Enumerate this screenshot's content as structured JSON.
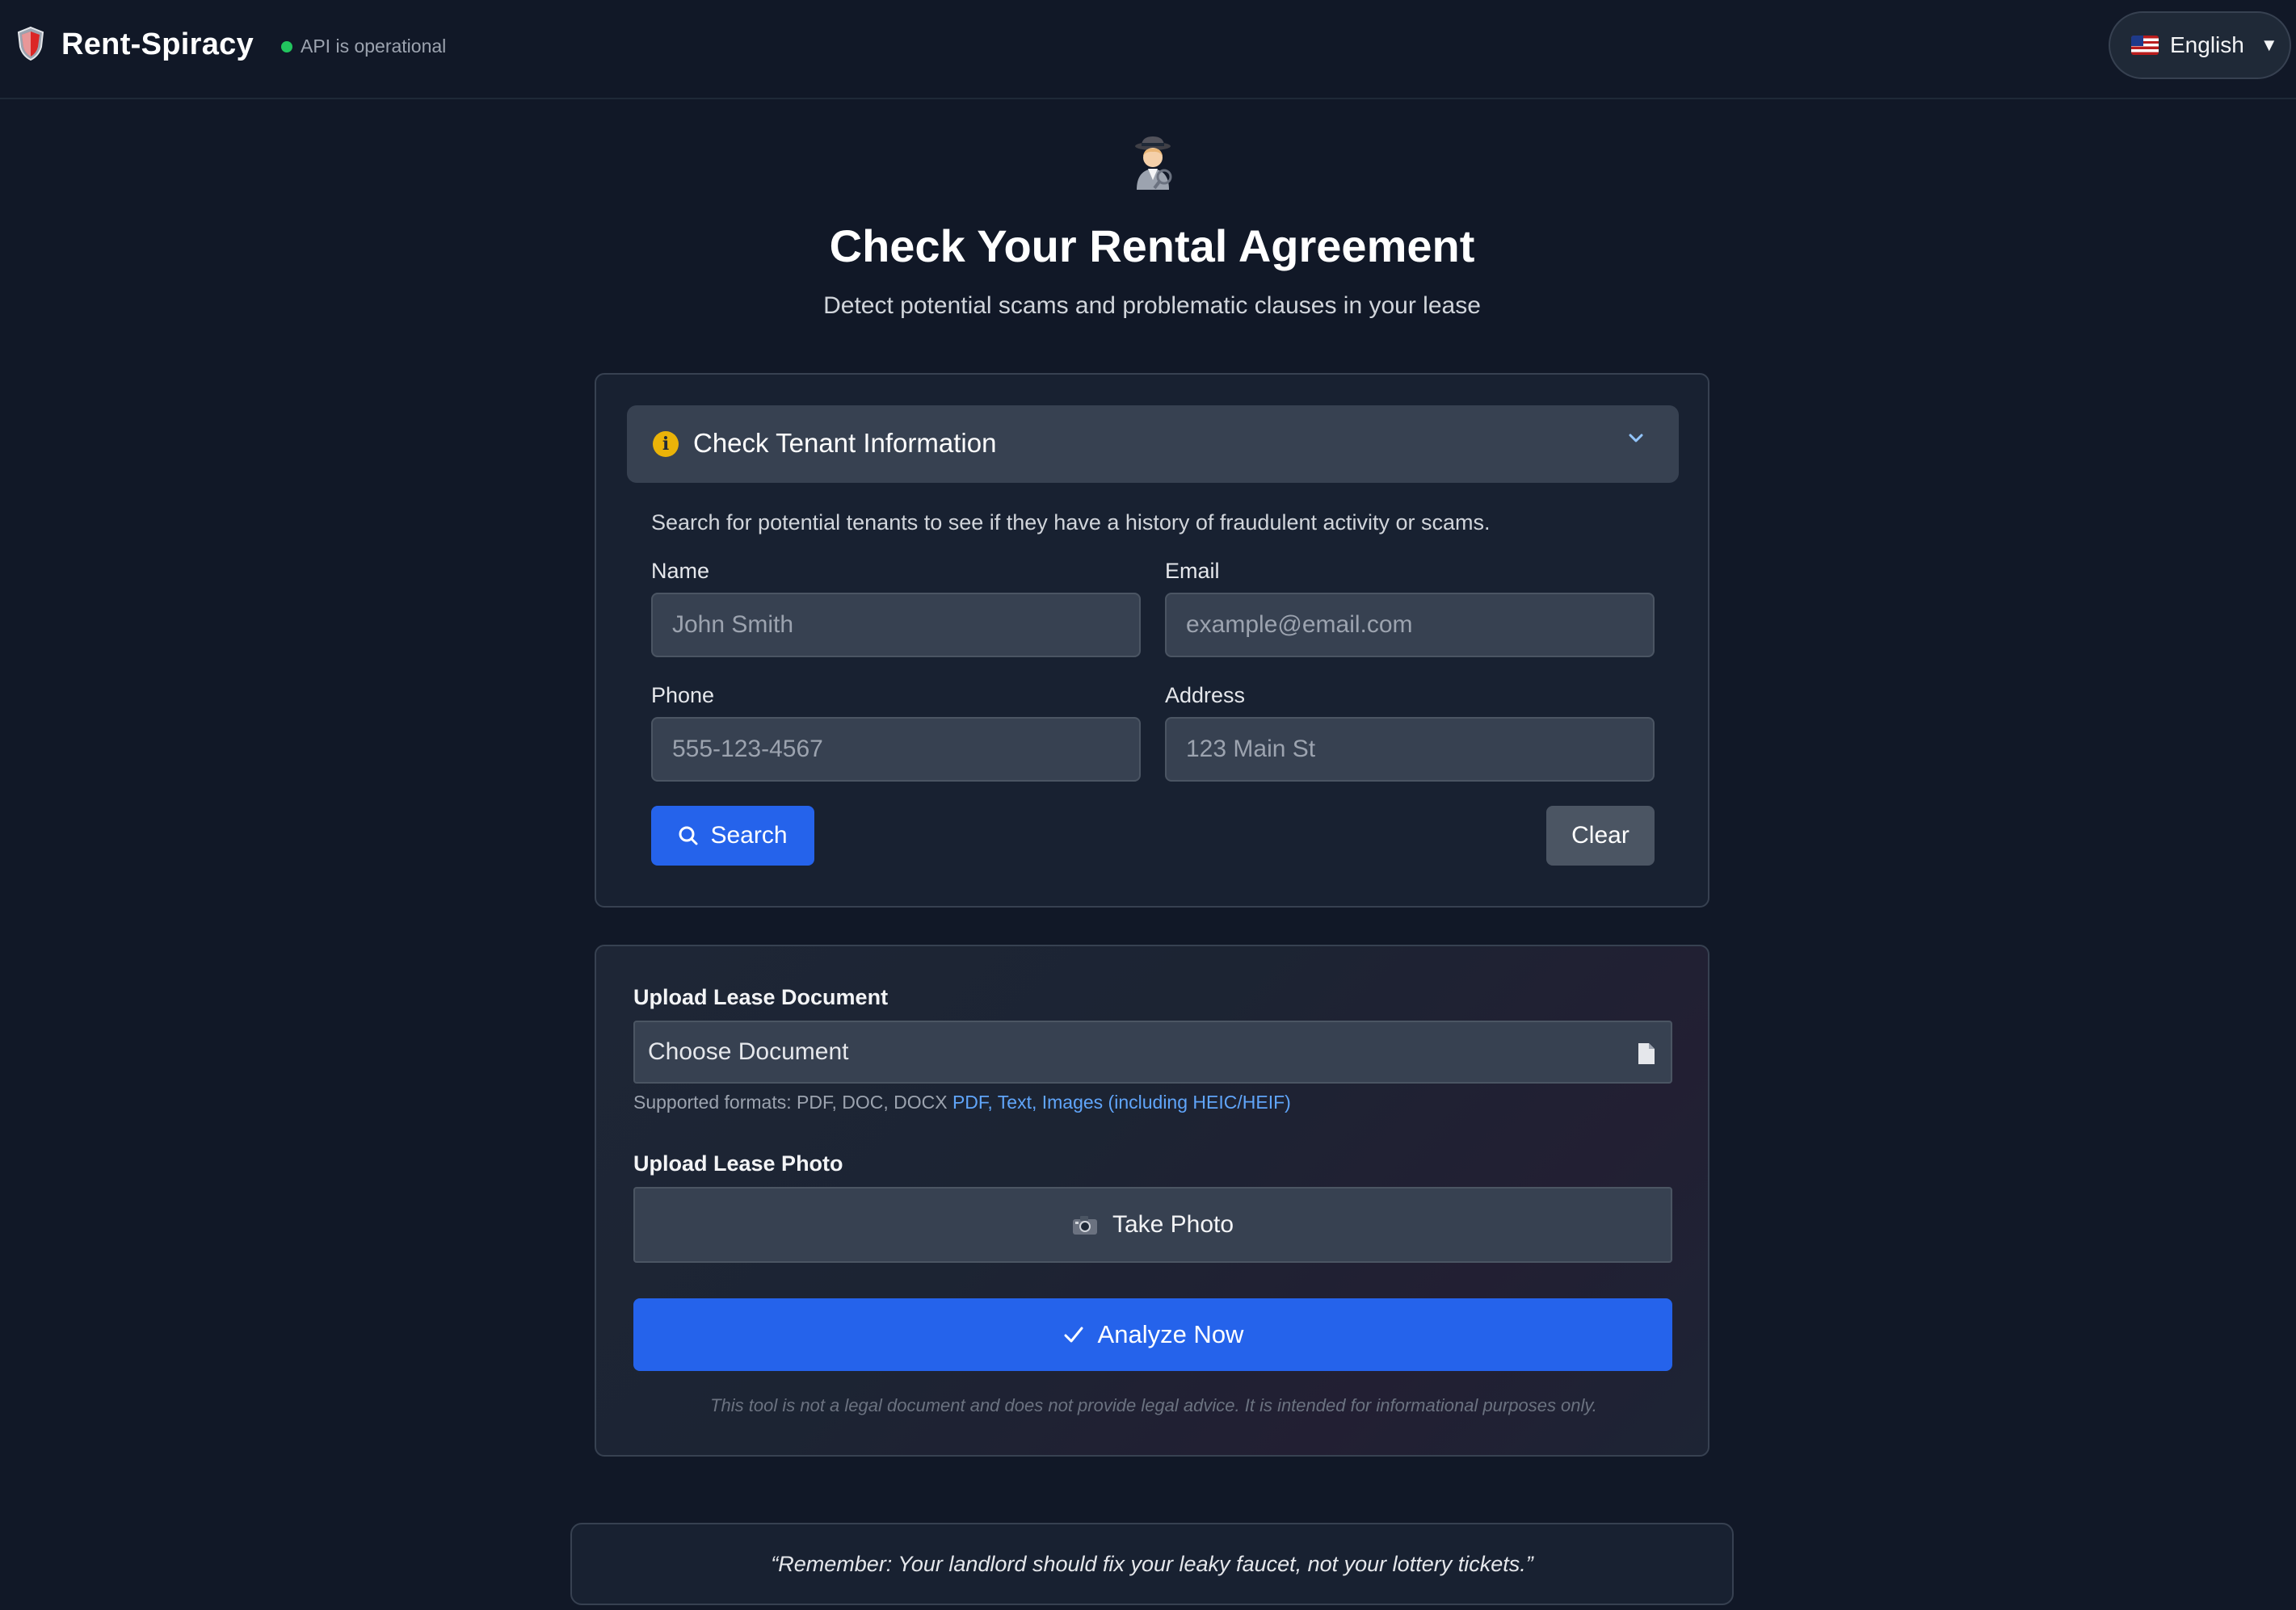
{
  "header": {
    "brand": "Rent-Spiracy",
    "status_text": "API is operational",
    "language": "English"
  },
  "hero": {
    "title": "Check Your Rental Agreement",
    "subtitle": "Detect potential scams and problematic clauses in your lease"
  },
  "tenant_check": {
    "title": "Check Tenant Information",
    "description": "Search for potential tenants to see if they have a history of fraudulent activity or scams.",
    "fields": {
      "name_label": "Name",
      "name_placeholder": "John Smith",
      "email_label": "Email",
      "email_placeholder": "example@email.com",
      "phone_label": "Phone",
      "phone_placeholder": "555-123-4567",
      "address_label": "Address",
      "address_placeholder": "123 Main St"
    },
    "search_label": "Search",
    "clear_label": "Clear"
  },
  "upload": {
    "doc_label": "Upload Lease Document",
    "doc_placeholder": "Choose Document",
    "formats_plain": "Supported formats: PDF, DOC, DOCX",
    "formats_link": "PDF, Text, Images (including HEIC/HEIF)",
    "photo_label": "Upload Lease Photo",
    "photo_button": "Take Photo",
    "analyze_button": "Analyze Now",
    "disclaimer": "This tool is not a legal document and does not provide legal advice. It is intended for informational purposes only."
  },
  "quote": "“Remember: Your landlord should fix your leaky faucet, not your lottery tickets.”",
  "colors": {
    "background": "#111827",
    "card": "#182131",
    "accent": "#2563eb",
    "status_ok": "#22c55e",
    "info": "#eab308"
  },
  "icons": [
    "shield-icon",
    "status-dot-icon",
    "us-flag-icon",
    "caret-down-icon",
    "detective-icon",
    "info-icon",
    "chevron-down-icon",
    "search-icon",
    "document-icon",
    "camera-icon",
    "checkmark-icon"
  ]
}
